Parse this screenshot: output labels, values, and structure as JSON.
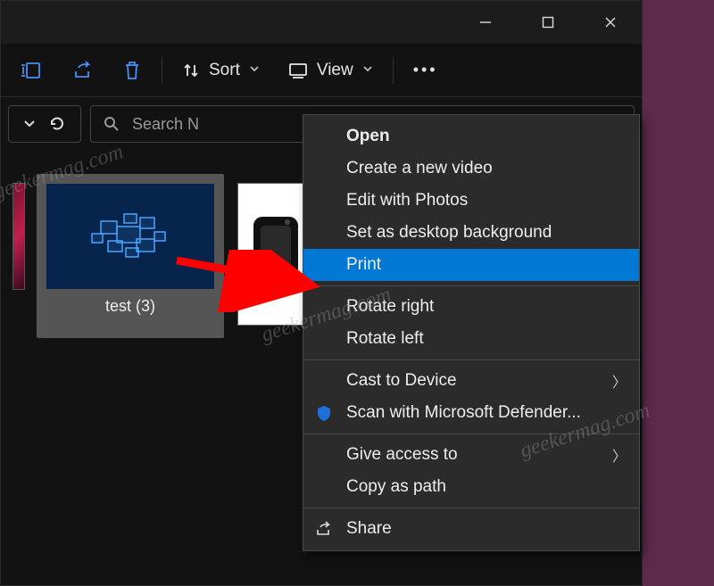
{
  "toolbar": {
    "sort_label": "Sort",
    "view_label": "View"
  },
  "search": {
    "placeholder": "Search N"
  },
  "gallery": {
    "thumb2_caption": "test (3)"
  },
  "context_menu": {
    "open": "Open",
    "create_video": "Create a new video",
    "edit_photos": "Edit with Photos",
    "set_bg": "Set as desktop background",
    "print": "Print",
    "rotate_right": "Rotate right",
    "rotate_left": "Rotate left",
    "cast": "Cast to Device",
    "scan_defender": "Scan with Microsoft Defender...",
    "give_access": "Give access to",
    "copy_path": "Copy as path",
    "share": "Share"
  },
  "watermark": "geekermag.com"
}
